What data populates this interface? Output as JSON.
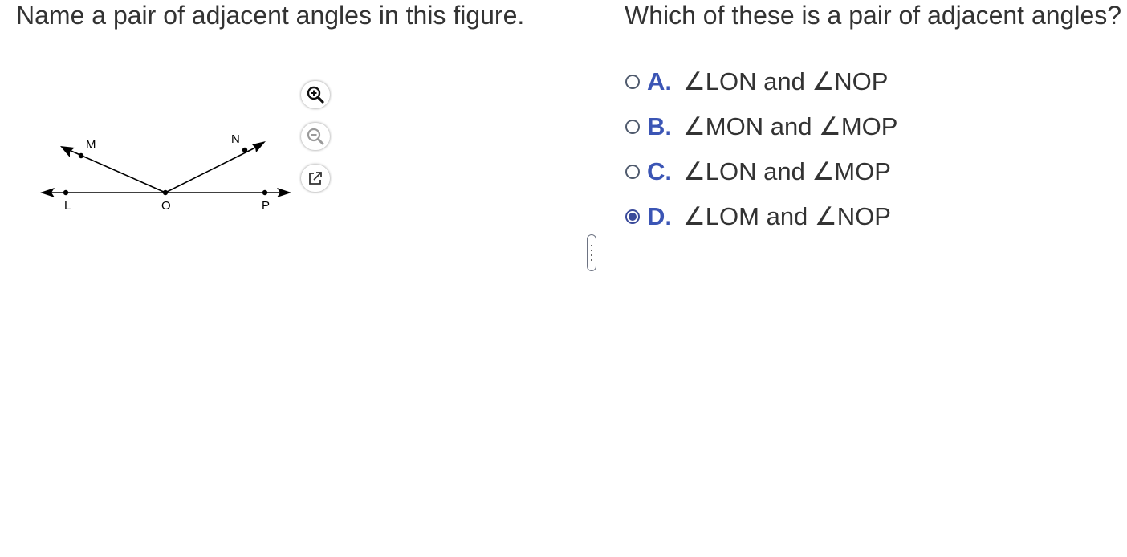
{
  "left": {
    "question": "Name a pair of adjacent angles in this figure.",
    "figure": {
      "points": [
        "L",
        "M",
        "O",
        "N",
        "P"
      ]
    },
    "tools": {
      "zoom_in": "zoom-in-icon",
      "zoom_out": "zoom-out-icon",
      "popout": "popout-icon"
    }
  },
  "right": {
    "question": "Which of these is a pair of adjacent angles?",
    "options": [
      {
        "letter": "A.",
        "text": "∠LON and ∠NOP",
        "selected": false
      },
      {
        "letter": "B.",
        "text": "∠MON and ∠MOP",
        "selected": false
      },
      {
        "letter": "C.",
        "text": "∠LON and ∠MOP",
        "selected": false
      },
      {
        "letter": "D.",
        "text": "∠LOM and ∠NOP",
        "selected": true
      }
    ]
  },
  "colors": {
    "accent": "#3b55b5",
    "text": "#333333",
    "divider": "#8a8f9c"
  }
}
